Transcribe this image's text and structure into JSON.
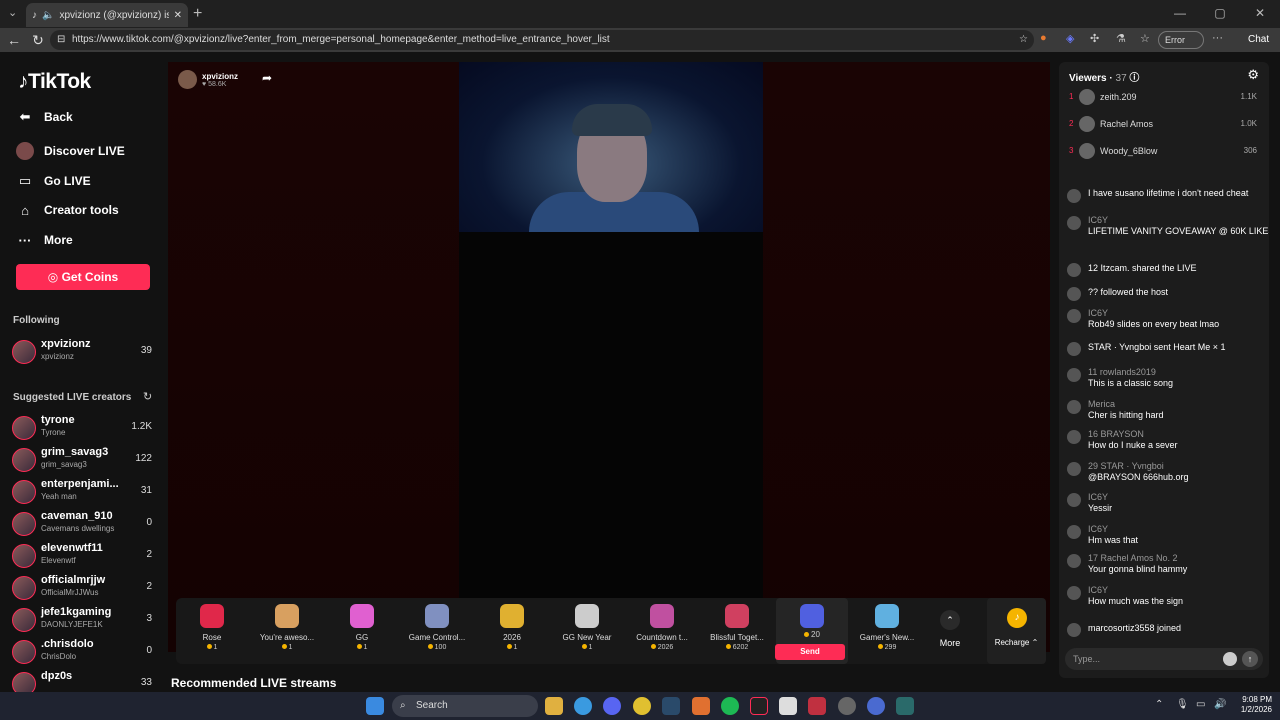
{
  "browser": {
    "tab_title": "xpvizionz (@xpvizionz) is LIVE",
    "url": "https://www.tiktok.com/@xpvizionz/live?enter_from_merge=personal_homepage&enter_method=live_entrance_hover_list",
    "error_label": "Error",
    "chat_label": "Chat"
  },
  "brand": "TikTok",
  "nav": {
    "back": "Back",
    "discover": "Discover LIVE",
    "go_live": "Go LIVE",
    "creator_tools": "Creator tools",
    "more": "More",
    "get_coins": "Get Coins"
  },
  "following": {
    "title": "Following",
    "items": [
      {
        "name": "xpvizionz",
        "sub": "xpvizionz",
        "count": "39"
      }
    ]
  },
  "suggested": {
    "title": "Suggested LIVE creators",
    "items": [
      {
        "name": "tyrone",
        "sub": "Tyrone",
        "count": "1.2K"
      },
      {
        "name": "grim_savag3",
        "sub": "grim_savag3",
        "count": "122"
      },
      {
        "name": "enterpenjami...",
        "sub": "Yeah man",
        "count": "31"
      },
      {
        "name": "caveman_910",
        "sub": "Cavemans dwellings",
        "count": "0"
      },
      {
        "name": "elevenwtf11",
        "sub": "Elevenwtf",
        "count": "2"
      },
      {
        "name": "officialmrjjw",
        "sub": "OfficialMrJJWus",
        "count": "2"
      },
      {
        "name": "jefe1kgaming",
        "sub": "DAONLYJEFE1K",
        "count": "3"
      },
      {
        "name": ".chrisdolo",
        "sub": "ChrisDolo",
        "count": "0"
      },
      {
        "name": "dpz0s",
        "sub": "",
        "count": "33"
      }
    ]
  },
  "host": {
    "name": "xpvizionz",
    "likes": "58.6K"
  },
  "gifts": [
    {
      "name": "Rose",
      "price": "1",
      "color": "#e0284a"
    },
    {
      "name": "You're aweso...",
      "price": "1",
      "color": "#d8a060"
    },
    {
      "name": "GG",
      "price": "1",
      "color": "#e060d0"
    },
    {
      "name": "Game Control...",
      "price": "100",
      "color": "#8090c0"
    },
    {
      "name": "2026",
      "price": "1",
      "color": "#e0b030"
    },
    {
      "name": "GG New Year",
      "price": "1",
      "color": "#cccccc"
    },
    {
      "name": "Countdown t...",
      "price": "2026",
      "color": "#c050a0"
    },
    {
      "name": "Blissful Toget...",
      "price": "6202",
      "color": "#d04060"
    },
    {
      "name": "",
      "price": "20",
      "color": "#5060e0"
    },
    {
      "name": "Gamer's New...",
      "price": "299",
      "color": "#60b0e0"
    }
  ],
  "gift_more": "More",
  "send": "Send",
  "recharge": "Recharge",
  "recommended": "Recommended LIVE streams",
  "viewers": {
    "title": "Viewers",
    "count": "37",
    "top": [
      {
        "rank": "1",
        "name": "zeith.209",
        "count": "1.1K"
      },
      {
        "rank": "2",
        "name": "Rachel Amos",
        "count": "1.0K"
      },
      {
        "rank": "3",
        "name": "Woody_6Blow",
        "count": "306"
      }
    ]
  },
  "chat": [
    {
      "user": "",
      "text": "I have susano lifetime i don't need cheat"
    },
    {
      "user": "IC6Y",
      "text": "LIFETIME VANITY GOVEAWAY @ 60K LIKES"
    },
    {
      "line": "12 Itzcam. shared the LIVE"
    },
    {
      "line": "?? followed the host"
    },
    {
      "user": "IC6Y",
      "text": "Rob49 slides on every beat lmao"
    },
    {
      "line": "STAR · Yvngboi sent Heart Me × 1"
    },
    {
      "user": "11 rowlands2019",
      "text": "This is a classic song"
    },
    {
      "user": "Merica",
      "text": "Cher is hitting hard"
    },
    {
      "user": "16 BRAYSON",
      "text": "How do I nuke a sever"
    },
    {
      "user": "29 STAR · Yvngboi",
      "text": "@BRAYSON 666hub.org"
    },
    {
      "user": "IC6Y",
      "text": "Yessir"
    },
    {
      "user": "IC6Y",
      "text": "Hm was that"
    },
    {
      "user": "17 Rachel Amos No. 2",
      "text": "Your gonna blind hammy"
    },
    {
      "user": "IC6Y",
      "text": "How much was the sign"
    },
    {
      "line": "marcosortiz3558 joined"
    }
  ],
  "type_placeholder": "Type...",
  "taskbar": {
    "search": "Search",
    "time": "9:08 PM",
    "date": "1/2/2026"
  }
}
